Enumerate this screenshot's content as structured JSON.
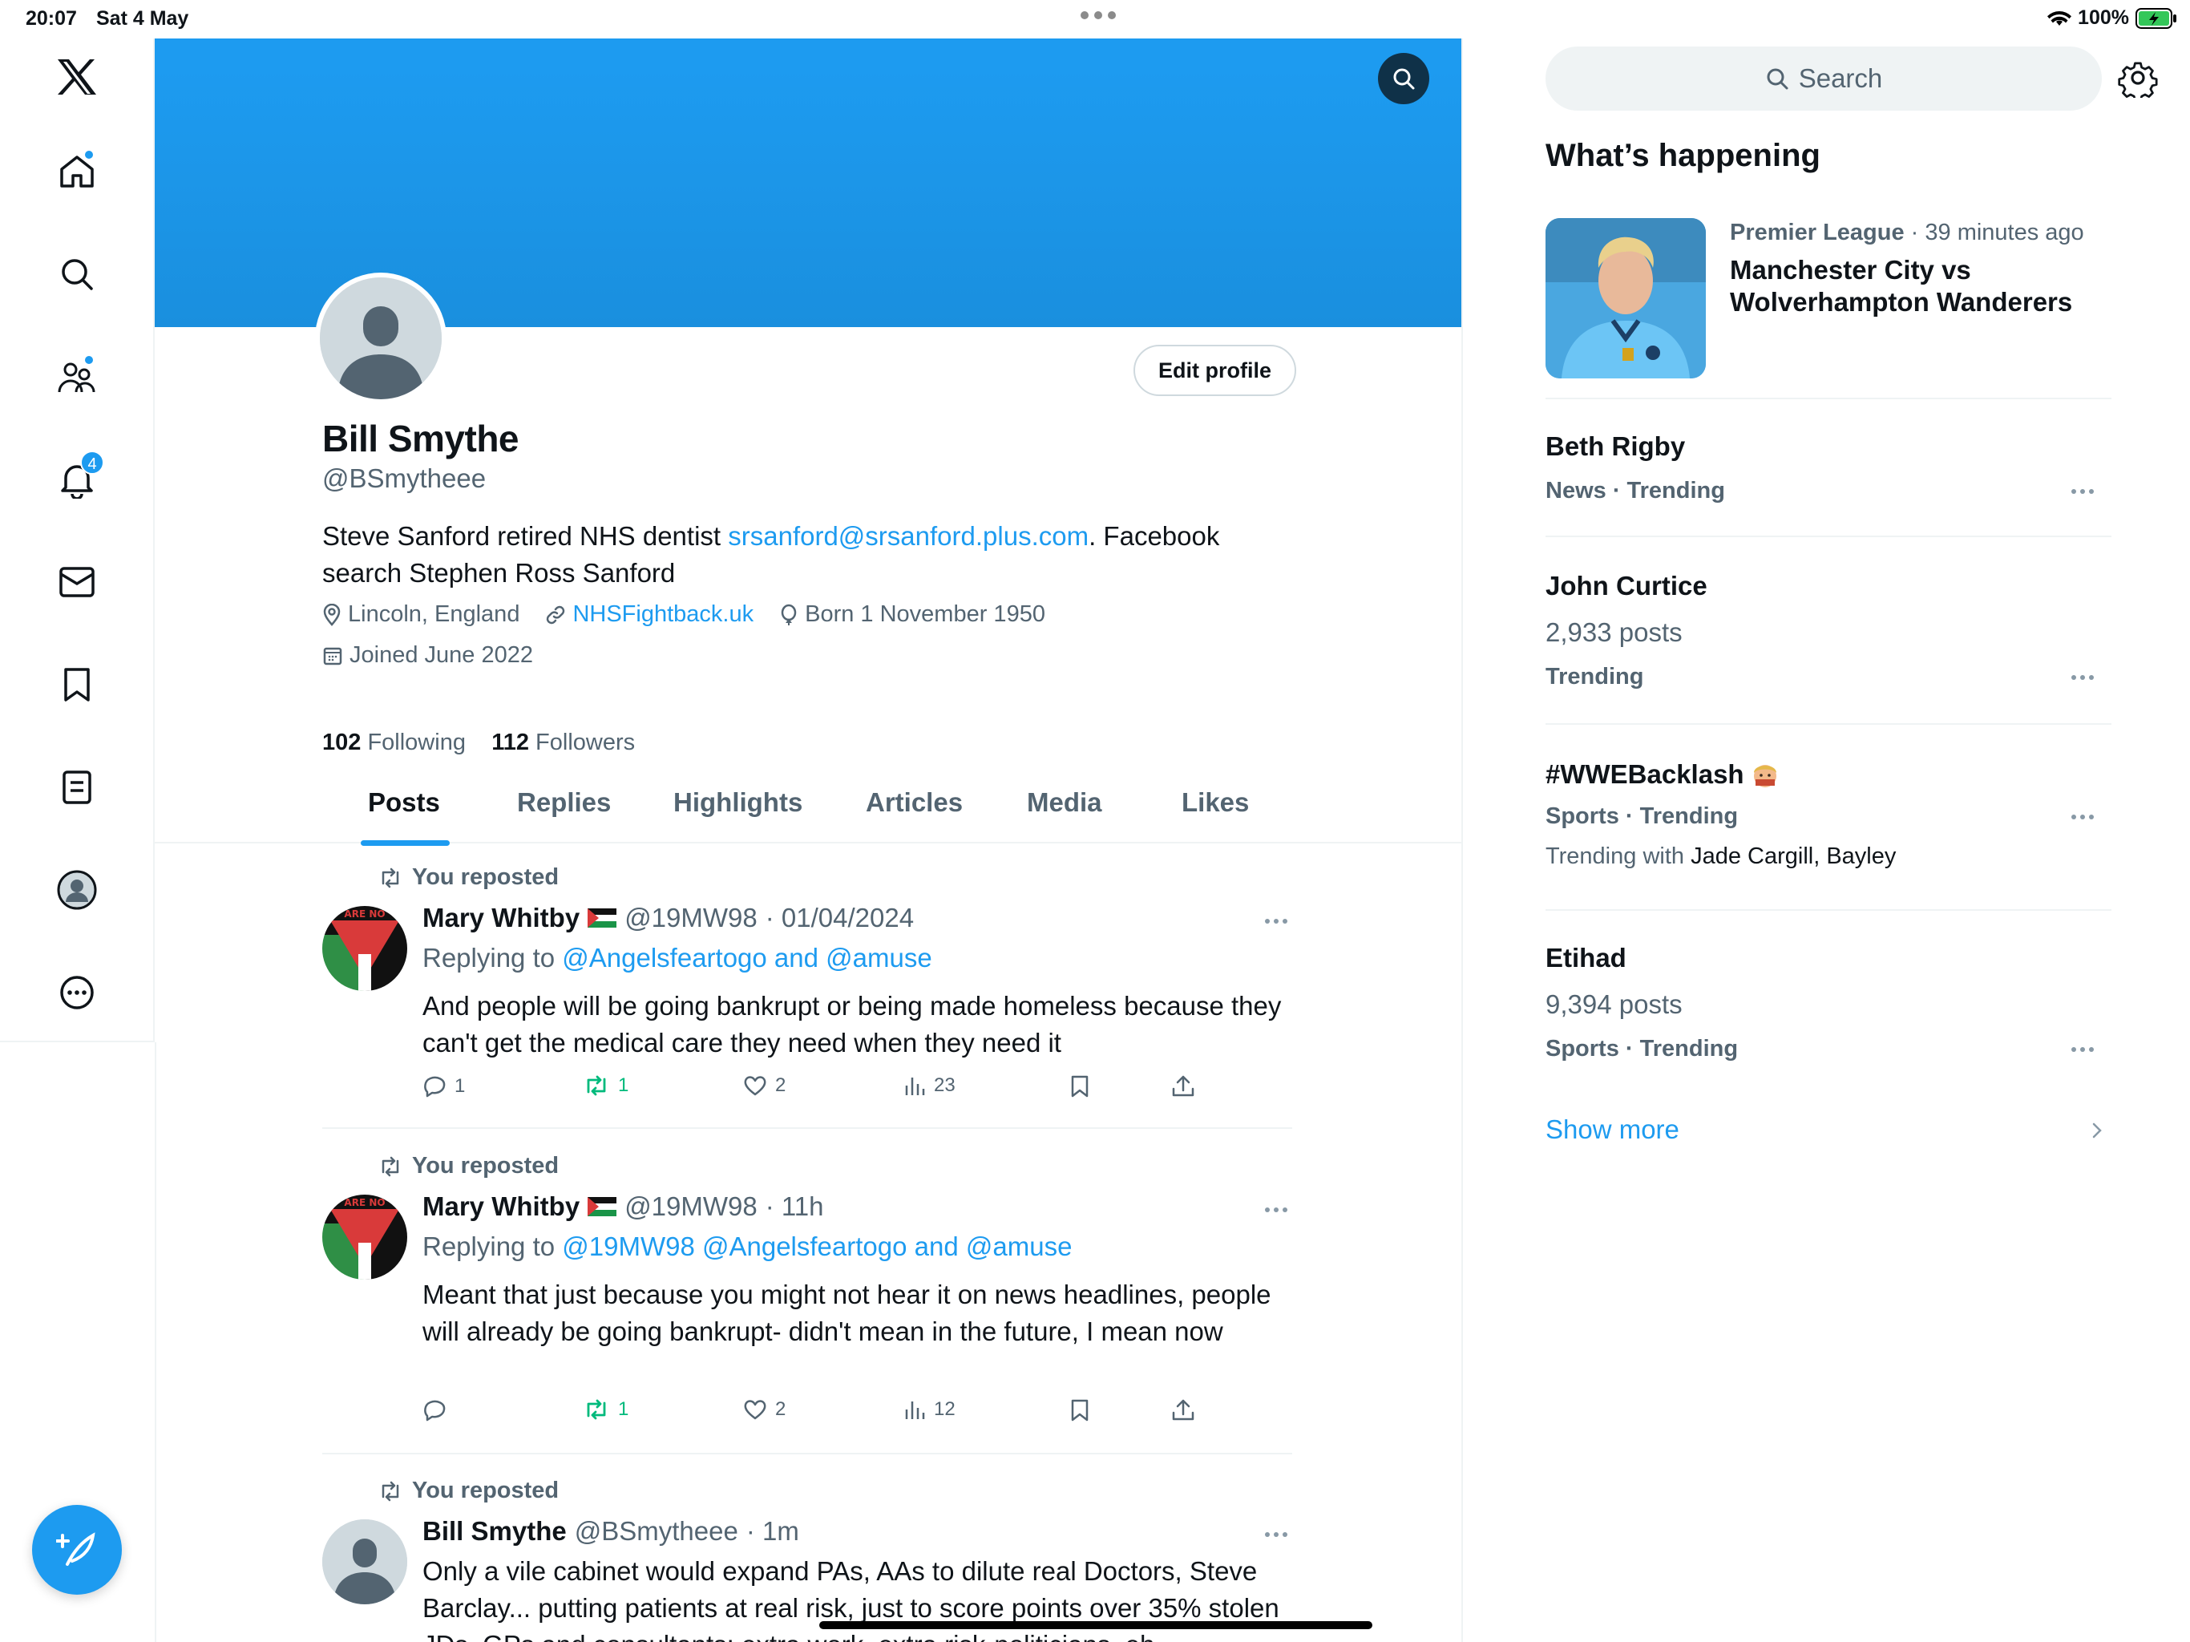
{
  "status_bar": {
    "time": "20:07",
    "date": "Sat 4 May",
    "battery": "100%"
  },
  "nav": {
    "items": [
      "x-logo",
      "home",
      "explore",
      "communities",
      "notifications",
      "messages",
      "bookmarks",
      "lists",
      "profile",
      "more"
    ],
    "notifications_count": "4"
  },
  "profile": {
    "name": "Bill Smythe",
    "handle": "@BSmytheee",
    "edit_label": "Edit profile",
    "bio_before": "Steve Sanford retired NHS dentist ",
    "bio_email": "srsanford@srsanford.plus.com",
    "bio_after": ". Facebook search Stephen Ross Sanford",
    "location": "Lincoln, England",
    "website": "NHSFightback.uk",
    "born": "Born 1 November 1950",
    "joined": "Joined June 2022",
    "following_count": "102",
    "following_label": "Following",
    "followers_count": "112",
    "followers_label": "Followers"
  },
  "tabs": [
    "Posts",
    "Replies",
    "Highlights",
    "Articles",
    "Media",
    "Likes"
  ],
  "posts": [
    {
      "repost_label": "You reposted",
      "name": "Mary Whitby",
      "handle": "@19MW98",
      "time": "· 01/04/2024",
      "replying_prefix": "Replying to ",
      "replying_to": "@Angelsfeartogo and @amuse",
      "text": "And people will be going bankrupt or being made homeless because they can't get the medical care they need when they need it",
      "replies": "1",
      "reposts": "1",
      "likes": "2",
      "views": "23"
    },
    {
      "repost_label": "You reposted",
      "name": "Mary Whitby",
      "handle": "@19MW98",
      "time": "· 11h",
      "replying_prefix": "Replying to ",
      "replying_to": "@19MW98 @Angelsfeartogo and @amuse",
      "text": "Meant that just because you might not hear it on news headlines, people will already be going bankrupt- didn't mean in the future, I mean now",
      "replies": "",
      "reposts": "1",
      "likes": "2",
      "views": "12"
    },
    {
      "repost_label": "You reposted",
      "name": "Bill Smythe",
      "handle": "@BSmytheee",
      "time": "· 1m",
      "text": "Only a vile cabinet would expand PAs, AAs to dilute real Doctors, Steve Barclay... putting patients at real risk, just to score points over 35% stolen JDs, GPs and consultants: extra work, extra risk-politicians, eh..."
    }
  ],
  "sidebar": {
    "search_placeholder": "Search",
    "heading": "What’s happening",
    "trend_feature": {
      "category": "Premier League",
      "time": " · 39 minutes ago",
      "title_line1": "Manchester City vs",
      "title_line2": "Wolverhampton Wanderers"
    },
    "trends": [
      {
        "title": "Beth Rigby",
        "meta": "News · Trending"
      },
      {
        "title": "John Curtice",
        "posts": "2,933 posts",
        "meta": "Trending"
      },
      {
        "title": "#WWEBacklash",
        "meta": "Sports · Trending",
        "with_prefix": "Trending with ",
        "with_names": "Jade Cargill, Bayley"
      },
      {
        "title": "Etihad",
        "posts": "9,394 posts",
        "meta": "Sports · Trending"
      }
    ],
    "show_more": "Show more"
  },
  "colors": {
    "accent": "#1d9bf0",
    "repost_green": "#00ba7c",
    "muted": "#536471",
    "text": "#0f1419"
  }
}
